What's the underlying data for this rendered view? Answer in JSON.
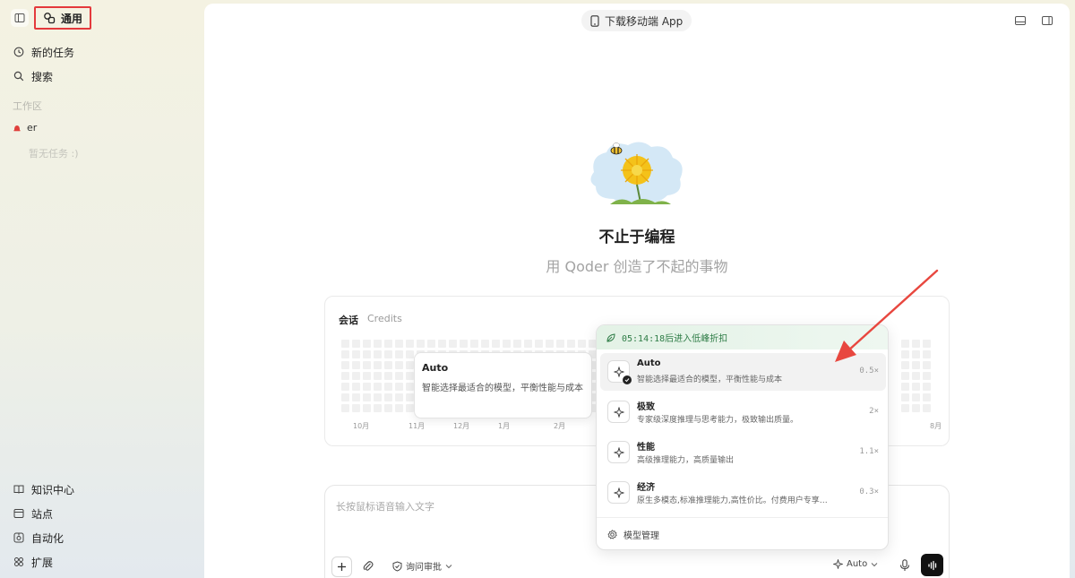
{
  "sidebar": {
    "workspace_label": "通用",
    "nav": [
      {
        "label": "新的任务",
        "icon": "new-task-icon"
      },
      {
        "label": "搜索",
        "icon": "search-icon"
      }
    ],
    "section_label": "工作区",
    "project": {
      "label": "er",
      "icon": "project-bell-icon"
    },
    "empty_text": "暂无任务 :)",
    "bottom": [
      {
        "label": "知识中心",
        "icon": "book-icon"
      },
      {
        "label": "站点",
        "icon": "site-icon"
      },
      {
        "label": "自动化",
        "icon": "automation-icon"
      },
      {
        "label": "扩展",
        "icon": "extension-icon"
      }
    ]
  },
  "header": {
    "download_label": "下载移动端 App"
  },
  "hero": {
    "title": "不止于编程",
    "subtitle": "用 Qoder 创造了不起的事物"
  },
  "stats": {
    "tabs": [
      "会话",
      "Credits"
    ],
    "months": [
      "10月",
      "11月",
      "12月",
      "1月",
      "2月",
      "8月"
    ]
  },
  "input": {
    "placeholder": "长按鼠标语音输入文字",
    "approval_label": "询问审批",
    "model_label": "Auto"
  },
  "tooltip": {
    "title": "Auto",
    "desc": "智能选择最适合的模型，平衡性能与成本"
  },
  "model_menu": {
    "banner": "05:14:18后进入低峰折扣",
    "options": [
      {
        "name": "Auto",
        "desc": "智能选择最适合的模型，平衡性能与成本",
        "multiplier": "0.5×",
        "selected": true
      },
      {
        "name": "极致",
        "desc": "专家级深度推理与思考能力，极致输出质量。",
        "multiplier": "2×",
        "selected": false
      },
      {
        "name": "性能",
        "desc": "高级推理能力，高质量输出",
        "multiplier": "1.1×",
        "selected": false
      },
      {
        "name": "经济",
        "desc": "原生多模态,标准推理能力,高性价比。付费用户专享…",
        "multiplier": "0.3×",
        "selected": false
      }
    ],
    "manage_label": "模型管理"
  },
  "colors": {
    "highlight_border": "#e4393c",
    "banner_green": "#2f7d47",
    "arrow": "#e8473f"
  }
}
